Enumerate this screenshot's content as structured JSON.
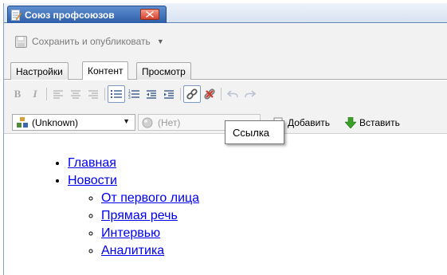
{
  "window": {
    "title": "Союз профсоюзов"
  },
  "publish": {
    "label": "Сохранить и опубликовать"
  },
  "mode_tabs": [
    {
      "label": "Настройки"
    },
    {
      "label": "Контент"
    },
    {
      "label": "Просмотр"
    }
  ],
  "format": {
    "bold": "B",
    "italic": "I"
  },
  "toolbar2": {
    "style_select": "(Unknown)",
    "image_select": "(Нет)",
    "add_label": "Добавить",
    "insert_label": "Вставить"
  },
  "tooltip": {
    "text": "Ссылка"
  },
  "content": {
    "items": [
      {
        "label": "Главная"
      },
      {
        "label": "Новости"
      }
    ],
    "subitems": [
      {
        "label": "От первого лица"
      },
      {
        "label": "Прямая речь"
      },
      {
        "label": "Интервью"
      },
      {
        "label": "Аналитика"
      }
    ]
  },
  "colors": {
    "accent": "#2d5ea8",
    "link": "#0000ee",
    "toolbar_bg": "#f2f2f2"
  }
}
